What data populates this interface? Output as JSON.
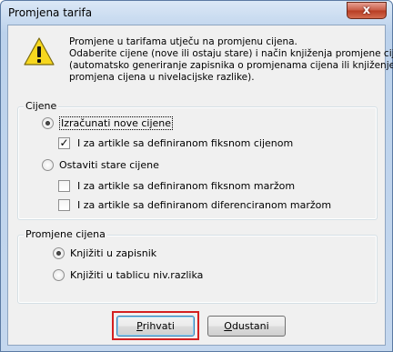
{
  "window": {
    "title": "Promjena tarifa",
    "close_glyph": "x"
  },
  "message": {
    "icon": "warning-icon",
    "lines": [
      "Promjene u tarifama utječu na promjenu cijena.",
      "Odaberite cijene (nove ili ostaju stare) i način knjiženja promjene cijena",
      "(automatsko generiranje zapisnika o promjenama cijena ili knjiženje",
      "promjena cijena u nivelacijske razlike)."
    ]
  },
  "prices_group": {
    "title": "Cijene",
    "calc_new": {
      "label": "Izračunati nove cijene",
      "checked": true
    },
    "fixed_price_articles": {
      "label": "I za artikle sa definiranom fiksnom cijenom",
      "checked": true
    },
    "keep_old": {
      "label": "Ostaviti stare cijene",
      "checked": false
    },
    "fixed_margin_articles": {
      "label": "I za artikle sa definiranom fiksnom maržom",
      "checked": false
    },
    "diff_margin_articles": {
      "label": "I za artikle sa definiranom diferenciranom maržom",
      "checked": false
    }
  },
  "price_change_group": {
    "title": "Promjene cijena",
    "book_record": {
      "label": "Knjižiti u zapisnik",
      "checked": true
    },
    "book_table": {
      "label": "Knjižiti u tablicu niv.razlika",
      "checked": false
    }
  },
  "buttons": {
    "accept_label_rest": "rihvati",
    "accept_mnemonic": "P",
    "cancel_label_rest": "dustani",
    "cancel_mnemonic": "O"
  },
  "colors": {
    "highlight": "#d42020",
    "close_button": "#c75a44"
  }
}
